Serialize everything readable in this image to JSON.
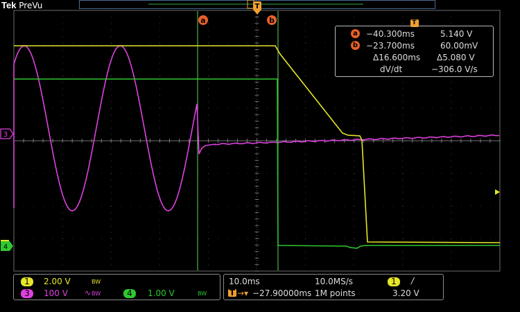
{
  "brand": {
    "name": "Tek",
    "mode": "PreVu"
  },
  "colors": {
    "ch1": "#e6e62a",
    "ch3": "#e040e0",
    "ch4": "#2fc82f",
    "cursor": "#5fd35f",
    "accent": "#e8602a",
    "grid": "#6c6c6c"
  },
  "trigger_badge": "T",
  "markers": {
    "a": "a",
    "b": "b",
    "ch3_ref": "3",
    "ch4_ref": "4"
  },
  "cursor_readout": {
    "title_icon": "T",
    "a": {
      "label": "a",
      "time": "−40.300ms",
      "value": "5.140 V"
    },
    "b": {
      "label": "b",
      "time": "−23.700ms",
      "value": "60.00mV"
    },
    "delta": {
      "time": "Δ16.600ms",
      "value": "Δ5.080 V"
    },
    "slope": {
      "label": "dV/dt",
      "value": "−306.0 V/s"
    }
  },
  "channels": {
    "ch1": {
      "num": "1",
      "scale": "2.00 V",
      "bw": "BW"
    },
    "ch3": {
      "num": "3",
      "scale": "100 V",
      "coupling": "∿",
      "bw": "BW"
    },
    "ch4": {
      "num": "4",
      "scale": "1.00 V",
      "bw": "BW"
    }
  },
  "timebase": {
    "scale": "10.0ms",
    "sample_rate": "10.0MS/s",
    "position": "−27.90000ms",
    "record_length": "1M points",
    "position_icon": "T"
  },
  "trigger": {
    "source": "1",
    "slope": "/",
    "level": "3.20 V"
  }
}
